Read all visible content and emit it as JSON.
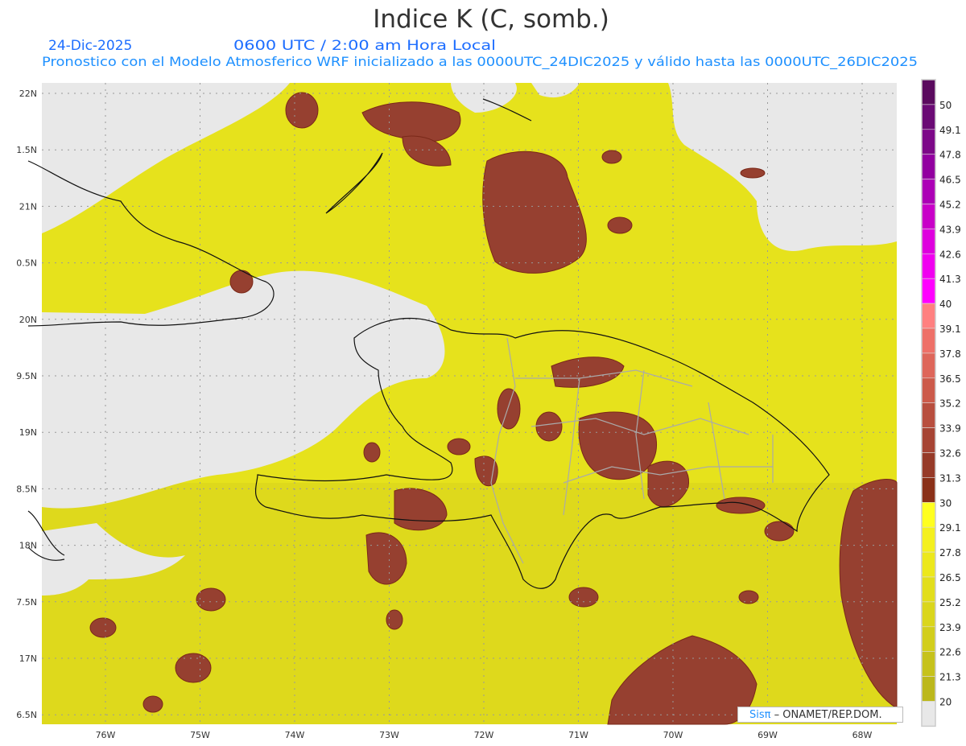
{
  "header": {
    "title": "Indice K (C, somb.)",
    "date": "24-Dic-2025",
    "time_label": "0600 UTC / 2:00 am Hora Local",
    "subtitle": "Pronostico con el Modelo Atmosferico WRF inicializado a las 0000UTC_24DIC2025 y válido hasta las  0000UTC_26DIC2025"
  },
  "axes": {
    "lat_labels": [
      "22N",
      "1.5N",
      "21N",
      "0.5N",
      "20N",
      "9.5N",
      "19N",
      "8.5N",
      "18N",
      "7.5N",
      "17N",
      "6.5N"
    ],
    "lon_labels": [
      "76W",
      "75W",
      "74W",
      "73W",
      "72W",
      "71W",
      "70W",
      "69W",
      "68W"
    ]
  },
  "colorbar": {
    "labels": [
      "50",
      "49.1",
      "47.8",
      "46.5",
      "45.2",
      "43.9",
      "42.6",
      "41.3",
      "40",
      "39.1",
      "37.8",
      "36.5",
      "35.2",
      "33.9",
      "32.6",
      "31.3",
      "30",
      "29.1",
      "27.8",
      "26.5",
      "25.2",
      "23.9",
      "22.6",
      "21.3",
      "20"
    ],
    "colors": [
      "#5a0a5e",
      "#6a0a74",
      "#7c0888",
      "#9200a0",
      "#ac00b6",
      "#c800c8",
      "#de00de",
      "#f000f0",
      "#ff00ff",
      "#ff8080",
      "#ee7068",
      "#de665a",
      "#cc5a4a",
      "#b84e3e",
      "#a64434",
      "#963a28",
      "#8a3018",
      "#ffff20",
      "#f4f01e",
      "#ece81c",
      "#e2de1c",
      "#dad61c",
      "#d2ce1c",
      "#c6c21c",
      "#bcb81c",
      "#e8e8e8"
    ]
  },
  "credit": {
    "brand": "Sisπ",
    "org": "– ONAMET/REP.DOM."
  },
  "colors": {
    "field": "#e6e21c",
    "low": "#e8e8e8",
    "high": "#964030",
    "header_blue": "#1e6eff",
    "subtitle_blue": "#1e90ff"
  }
}
